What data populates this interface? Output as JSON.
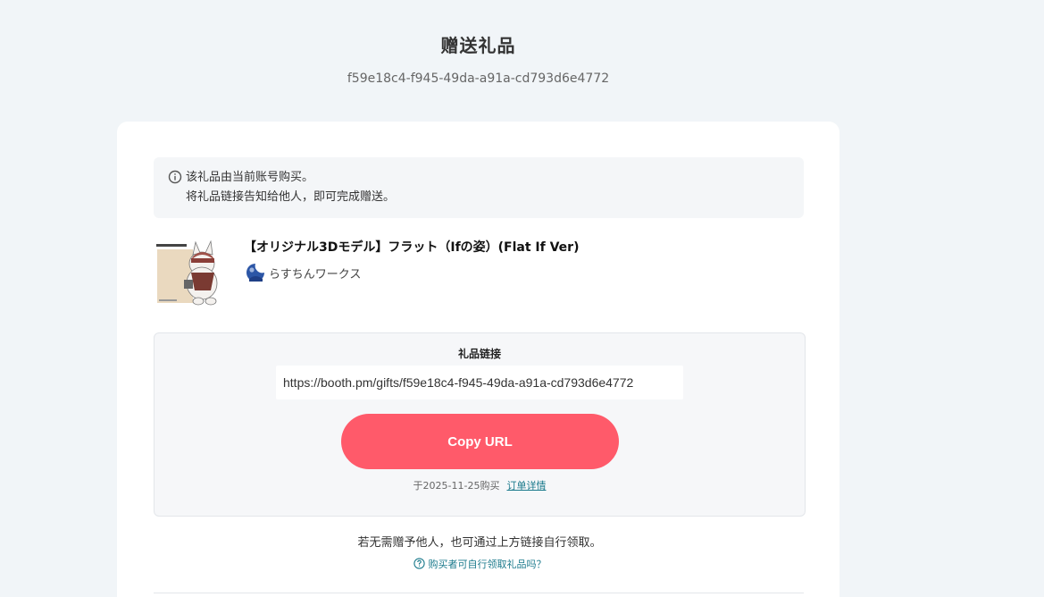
{
  "header": {
    "title": "赠送礼品",
    "gift_id": "f59e18c4-f945-49da-a91a-cd793d6e4772"
  },
  "notice": {
    "icon": "info-circle-icon",
    "line1": "该礼品由当前账号购买。",
    "line2": "将礼品链接告知给他人，即可完成赠送。"
  },
  "product": {
    "title": "【オリジナル3Dモデル】フラット（Ifの姿）(Flat If Ver)",
    "shop_name": "らすちんワークス"
  },
  "gift_link": {
    "heading": "礼品链接",
    "url": "https://booth.pm/gifts/f59e18c4-f945-49da-a91a-cd793d6e4772",
    "copy_label": "Copy URL",
    "purchase_text": "于2025-11-25购买",
    "order_link_label": "订单详情"
  },
  "footer": {
    "note": "若无需赠予他人，也可通过上方链接自行领取。",
    "faq_label": "购买者可自行领取礼品吗？"
  },
  "colors": {
    "accent": "#ff5a6a",
    "link": "#1b7a8c",
    "background": "#f1f5f8"
  }
}
